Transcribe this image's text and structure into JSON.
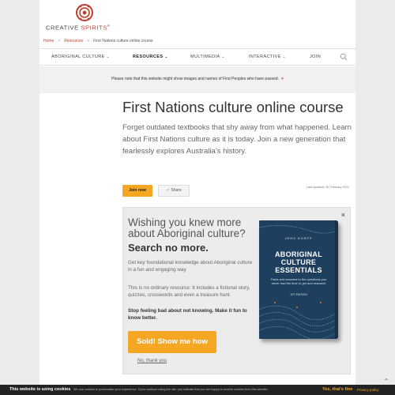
{
  "site": {
    "logo_main": "CREATIVE ",
    "logo_accent": "SPIRITS",
    "logo_mark": "®"
  },
  "breadcrumb": [
    "Home",
    "Resources",
    "First Nations culture online course"
  ],
  "breadcrumb_sep": ">",
  "nav": {
    "items": [
      {
        "label": "ABORIGINAL CULTURE",
        "chevron": "⌄"
      },
      {
        "label": "RESOURCES",
        "chevron": "⌄"
      },
      {
        "label": "MULTIMEDIA",
        "chevron": "⌄"
      },
      {
        "label": "INTERACTIVE",
        "chevron": "⌄"
      },
      {
        "label": "JOIN"
      }
    ],
    "search_icon": "search-icon"
  },
  "notice": {
    "text": "Please note that this website might show images and names of First Peoples who have passed.",
    "close": "×"
  },
  "article": {
    "title": "First Nations culture online course",
    "intro": "Forget outdated textbooks that shy away from what happened. Learn about First Nations culture as it is today. Join a new generation that fearlessly explores Australia’s history.",
    "join_label": "Join now",
    "share_label": "Share",
    "updated": "Last updated: 26 February 2021"
  },
  "promo": {
    "close": "×",
    "heading": "Wishing you knew more about Aboriginal culture?",
    "subheading": "Search no more.",
    "p1": "Get key foundational knowledge about Aboriginal culture in a fun and engaging way.",
    "p2": "This is no ordinary resource: It includes a fictional story, quizzes, crosswords and even a treasure hunt.",
    "p3": "Stop feeling bad about not knowing. Make it fun to know better.",
    "cta": "Sold! Show me how",
    "decline": "No, thank you",
    "book": {
      "author": "JENS KORFF",
      "title": "ABORIGINAL CULTURE ESSENTIALS",
      "subtitle": "Facts and answers to the questions you never had the time to get and research",
      "edition": "1ST EDITION"
    }
  },
  "cookie": {
    "title": "This website is using cookies",
    "message": "We use cookies to personalise your experience. If you continue using the site, you indicate that you are happy to receive cookies from this website.",
    "accept": "Yes, that's fine",
    "privacy": "Privacy policy"
  },
  "colors": {
    "accent": "#c63a2a",
    "cta": "#f5a623",
    "book": "#1f3f5f"
  }
}
